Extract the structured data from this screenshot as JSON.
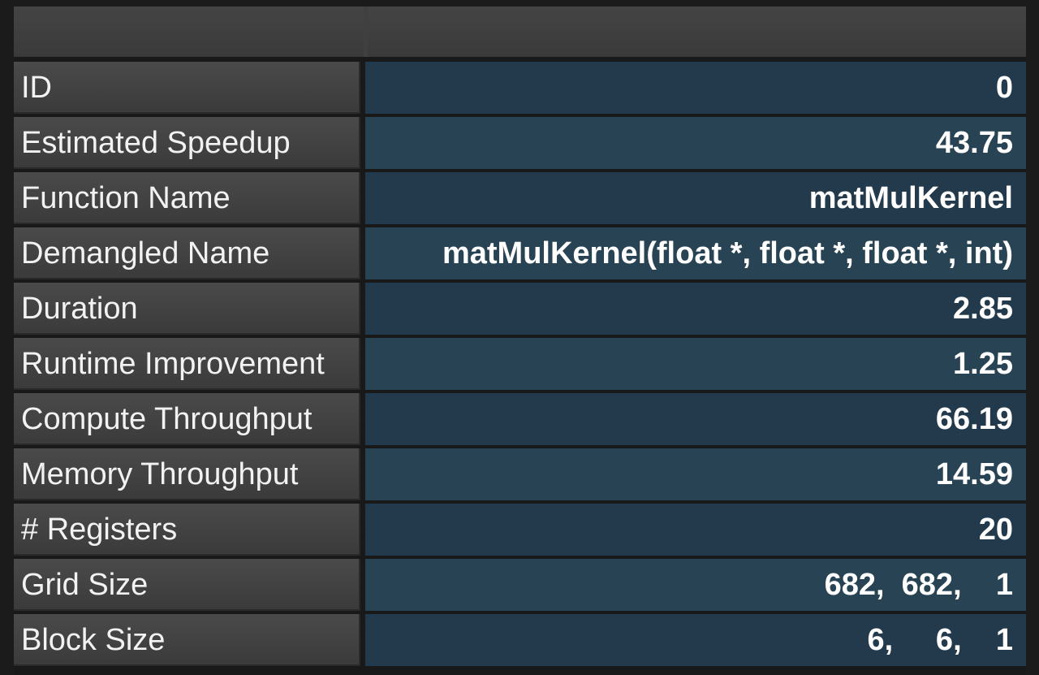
{
  "table": {
    "rows": [
      {
        "label": "ID",
        "value": "0"
      },
      {
        "label": "Estimated Speedup",
        "value": "43.75"
      },
      {
        "label": "Function Name",
        "value": "matMulKernel"
      },
      {
        "label": "Demangled Name",
        "value": "matMulKernel(float *, float *, float *, int)"
      },
      {
        "label": "Duration",
        "value": "2.85"
      },
      {
        "label": "Runtime Improvement",
        "value": "1.25"
      },
      {
        "label": "Compute Throughput",
        "value": "66.19"
      },
      {
        "label": "Memory Throughput",
        "value": "14.59"
      },
      {
        "label": "# Registers",
        "value": "20"
      },
      {
        "label": "Grid Size",
        "value": "682,  682,    1"
      },
      {
        "label": "Block Size",
        "value": "6,     6,    1"
      }
    ]
  },
  "colors": {
    "label_bg": "#424242",
    "value_bg": "#233a4c",
    "value_bg_alt": "#274354",
    "text": "#ffffff"
  }
}
